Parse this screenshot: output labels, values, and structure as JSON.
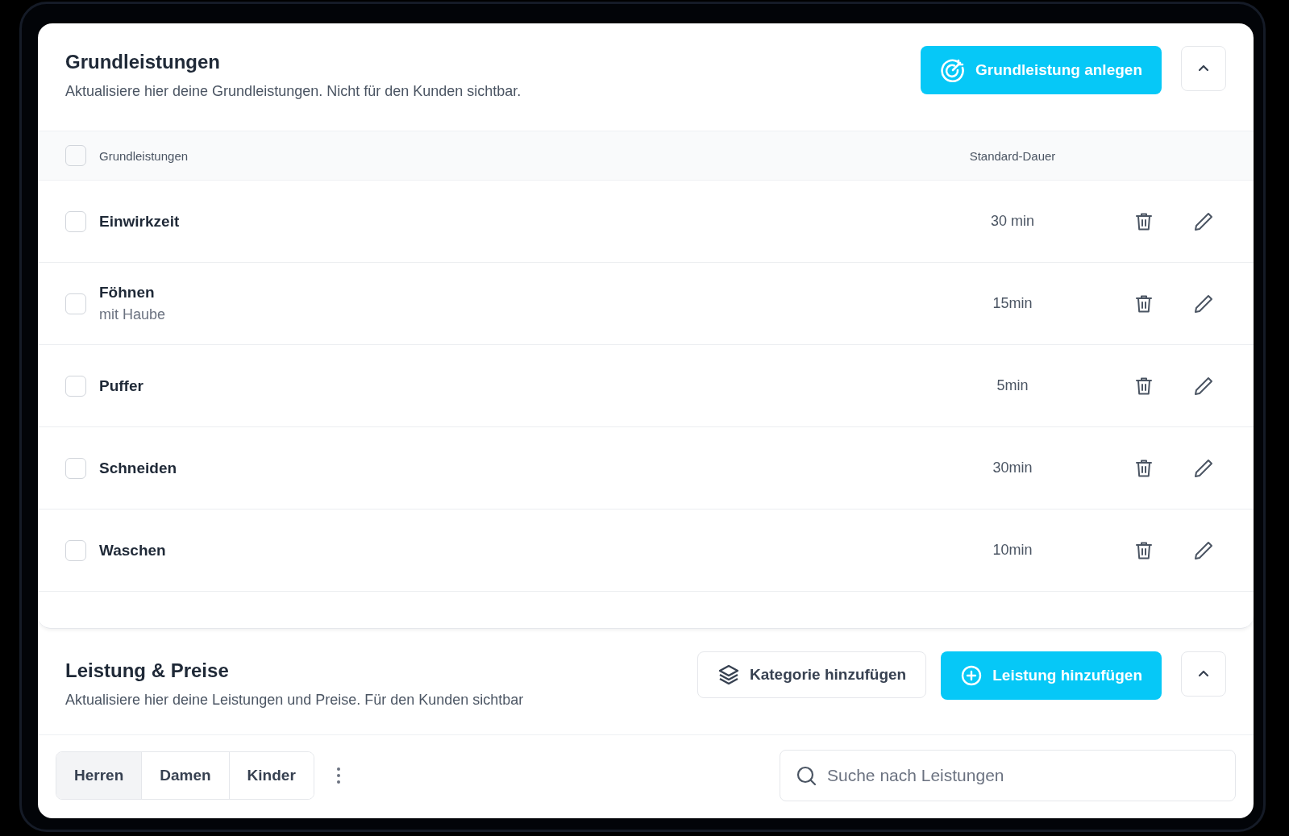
{
  "basic_services": {
    "title": "Grundleistungen",
    "subtitle": "Aktualisiere hier deine Grundleistungen. Nicht für den Kunden sichtbar.",
    "add_button": "Grundleistung anlegen",
    "expanded": true,
    "table": {
      "select_all_checked": false,
      "columns": [
        "Grundleistungen",
        "Standard-Dauer"
      ],
      "rows": [
        {
          "name": "Einwirkzeit",
          "duration": "30 min",
          "checked": false
        },
        {
          "name": "Föhnen",
          "note": "mit Haube",
          "duration": "15min",
          "checked": false
        },
        {
          "name": "Puffer",
          "duration": "5min",
          "checked": false
        },
        {
          "name": "Schneiden",
          "duration": "30min",
          "checked": false
        },
        {
          "name": "Waschen",
          "duration": "10min",
          "checked": false
        }
      ]
    }
  },
  "services_prices": {
    "title": "Leistung & Preise",
    "subtitle": "Aktualisiere hier deine Leistungen und Preise. Für den Kunden sichtbar",
    "category_button": "Kategorie hinzufügen",
    "add_button": "Leistung hinzufügen",
    "expanded": true,
    "tabs": [
      {
        "label": "Herren",
        "selected": true
      },
      {
        "label": "Damen",
        "selected": false
      },
      {
        "label": "Kinder",
        "selected": false
      }
    ],
    "search": {
      "placeholder": "Suche nach Leistungen"
    }
  }
}
